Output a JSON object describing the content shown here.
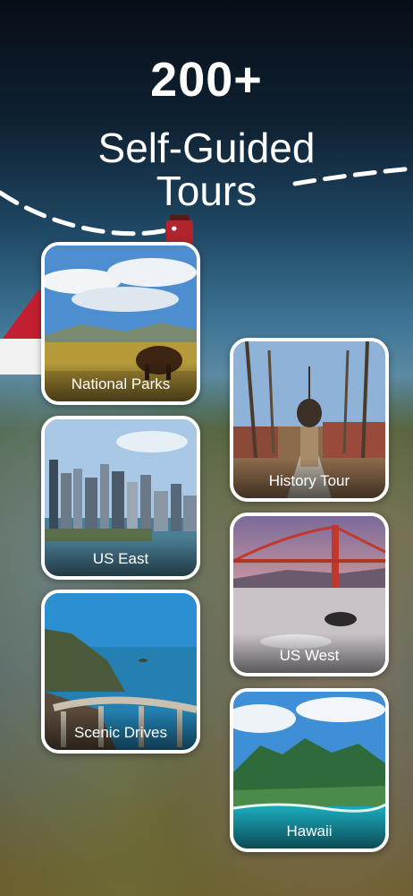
{
  "header": {
    "count": "200+",
    "line1": "Self-Guided",
    "line2": "Tours"
  },
  "cards": [
    {
      "label": "National Parks"
    },
    {
      "label": "History Tour"
    },
    {
      "label": "US East"
    },
    {
      "label": "US West"
    },
    {
      "label": "Scenic Drives"
    },
    {
      "label": "Hawaii"
    }
  ]
}
